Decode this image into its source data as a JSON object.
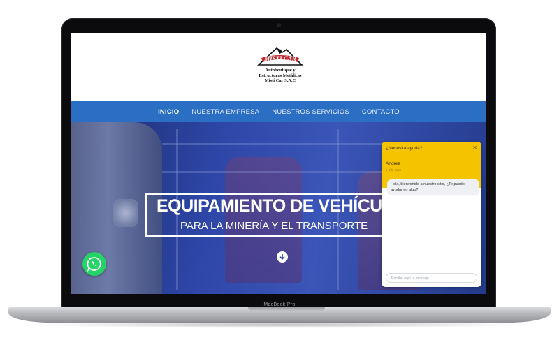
{
  "device": {
    "model_label": "MacBook Pro"
  },
  "site": {
    "logo": {
      "brand": "MISTI CAR",
      "lines": [
        "Autoboutique y",
        "Estructuras Metálicas",
        "Misti Car S.A.C"
      ]
    },
    "nav": [
      {
        "label": "INICIO",
        "active": true
      },
      {
        "label": "NUESTRA EMPRESA",
        "active": false
      },
      {
        "label": "NUESTROS SERVICIOS",
        "active": false
      },
      {
        "label": "CONTACTO",
        "active": false
      }
    ],
    "hero": {
      "title": "EQUIPAMIENTO DE VEHÍCULOS",
      "subtitle": "PARA LA MINERÍA Y EL TRANSPORTE"
    },
    "whatsapp_icon": "whatsapp-icon",
    "chat": {
      "header": "¿Necesita ayuda?",
      "agent": "Andrea",
      "time": "● 1 h. hace",
      "message": "Hola, bienvenido a nuestro sitio, ¿Te puedo ayudar en algo?",
      "input_placeholder": "Escribe aquí tu mensaje...",
      "close_icon": "close-icon"
    }
  },
  "colors": {
    "nav_bg": "#2a6fc4",
    "chat_header": "#f5c400",
    "whatsapp": "#25d366",
    "logo_red": "#c0282f"
  }
}
